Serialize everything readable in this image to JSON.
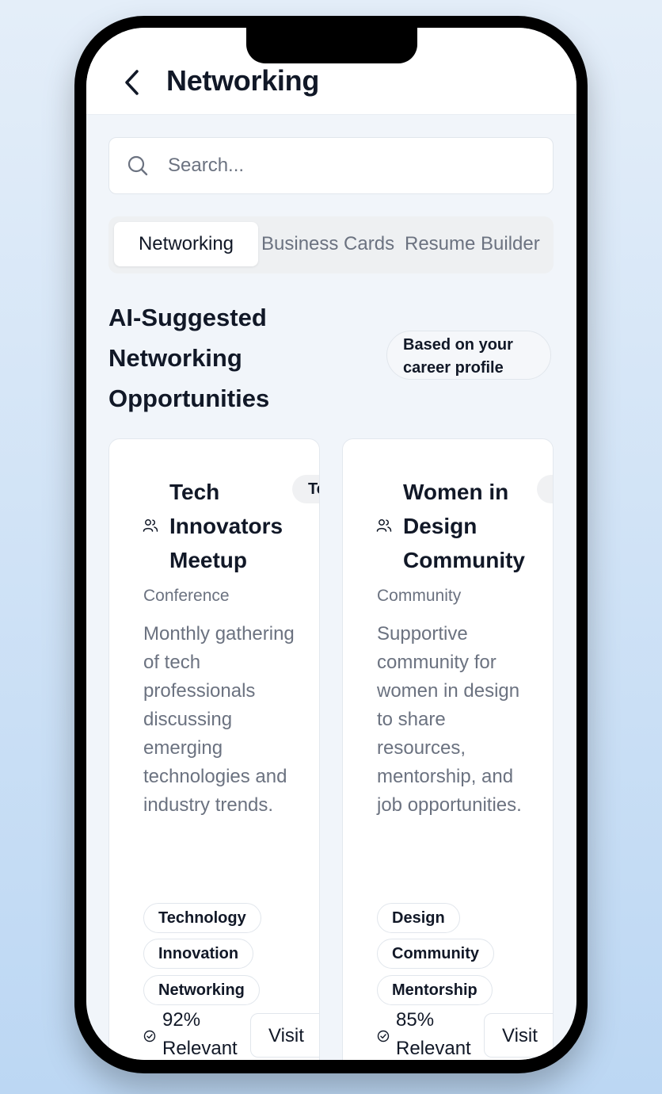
{
  "header": {
    "title": "Networking",
    "back_icon": "chevron-left-icon"
  },
  "search": {
    "placeholder": "Search...",
    "value": "",
    "icon": "search-icon"
  },
  "tabs": [
    {
      "label": "Networking",
      "active": true
    },
    {
      "label": "Business Cards",
      "active": false
    },
    {
      "label": "Resume Builder",
      "active": false
    }
  ],
  "section": {
    "title": "AI-Suggested Networking Opportunities",
    "badge": "Based on your career profile"
  },
  "cards": [
    {
      "name": "Tech Innovators Meetup",
      "category_pill": "Te",
      "type": "Conference",
      "description": "Monthly gathering of tech professionals discussing emerging technologies and industry trends.",
      "tags": [
        "Technology",
        "Innovation",
        "Networking"
      ],
      "relevance": "92% Relevant",
      "action": "Visit"
    },
    {
      "name": "Women in Design Community",
      "category_pill": "",
      "type": "Community",
      "description": "Supportive community for women in design to share resources, mentorship, and job opportunities.",
      "tags": [
        "Design",
        "Community",
        "Mentorship"
      ],
      "relevance": "85% Relevant",
      "action": "Visit"
    }
  ],
  "colors": {
    "background_top": "#e4eef9",
    "background_bottom": "#bcd7f3",
    "text_primary": "#111827",
    "text_secondary": "#6b7280"
  }
}
